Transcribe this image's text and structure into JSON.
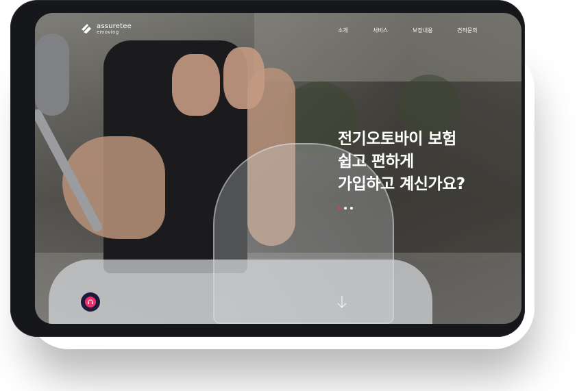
{
  "brand": {
    "name": "assuretee",
    "sub": "emoving"
  },
  "nav": {
    "items": [
      {
        "label": "소개"
      },
      {
        "label": "서비스"
      },
      {
        "label": "보장내용"
      },
      {
        "label": "견적문의"
      }
    ]
  },
  "hero": {
    "line1": "전기오토바이 보험",
    "line2": "쉽고 편하게",
    "line3": "가입하고 계신가요?"
  },
  "slider": {
    "count": 3,
    "active_index": 0
  },
  "colors": {
    "accent": "#e8336d",
    "device_frame": "#16171a",
    "chat_bg": "#1f1a3a"
  },
  "icons": {
    "logo": "assuretee-logo-icon",
    "scroll": "arrow-down-icon",
    "chat": "headset-icon"
  }
}
